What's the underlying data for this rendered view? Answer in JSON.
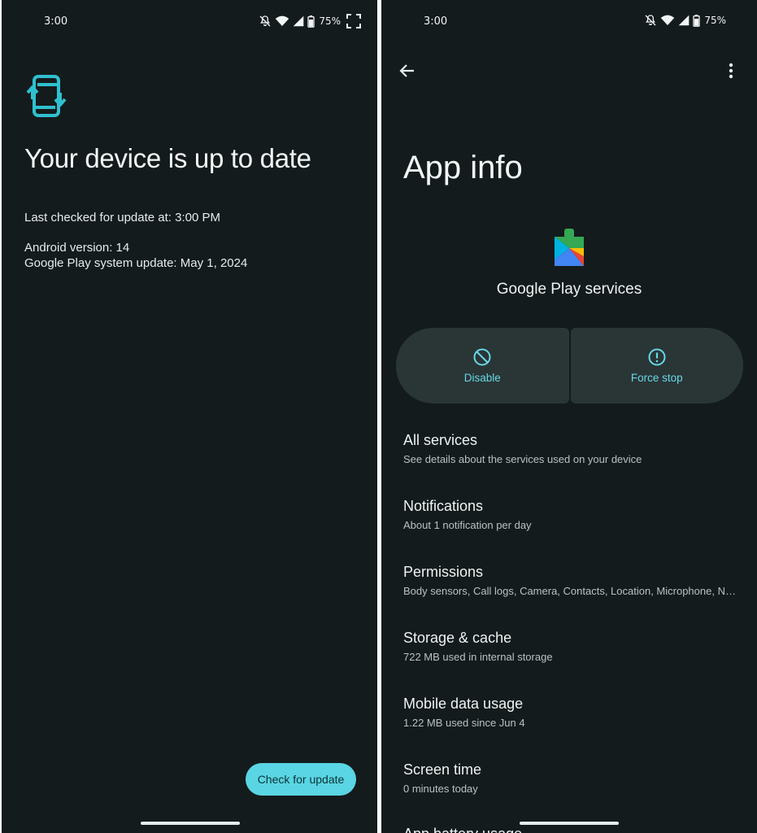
{
  "left_screen": {
    "status_bar": {
      "time": "3:00",
      "battery": "75%"
    },
    "title": "Your device is up to date",
    "last_checked": "Last checked for update at: 3:00 PM",
    "android_version": "Android version: 14",
    "play_system_update": "Google Play system update: May 1, 2024",
    "check_button_label": "Check for update",
    "accent_color": "#5ad5e3"
  },
  "right_screen": {
    "status_bar": {
      "time": "3:00",
      "battery": "75%"
    },
    "title": "App info",
    "app_name": "Google Play services",
    "actions": [
      {
        "label": "Disable",
        "icon": "disable-icon"
      },
      {
        "label": "Force stop",
        "icon": "force-stop-icon"
      }
    ],
    "items": [
      {
        "title": "All services",
        "summary": "See details about the services used on your device"
      },
      {
        "title": "Notifications",
        "summary": "About 1 notification per day"
      },
      {
        "title": "Permissions",
        "summary": "Body sensors, Call logs, Camera, Contacts, Location, Microphone, Nearby devices, Phone, Physical activity, SMS, and Storage"
      },
      {
        "title": "Storage & cache",
        "summary": "722 MB used in internal storage"
      },
      {
        "title": "Mobile data usage",
        "summary": "1.22 MB used since Jun 4"
      },
      {
        "title": "Screen time",
        "summary": "0 minutes today"
      },
      {
        "title": "App battery usage",
        "summary": ""
      }
    ]
  }
}
